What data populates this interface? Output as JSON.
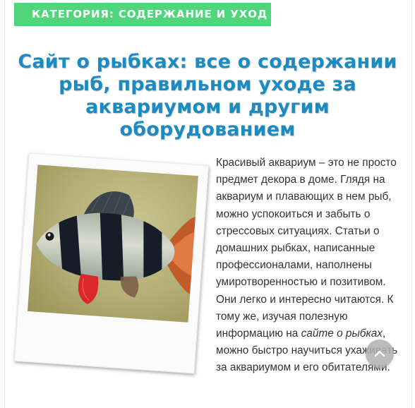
{
  "category": {
    "label": "КАТЕГОРИЯ: СОДЕРЖАНИЕ И УХОД"
  },
  "article": {
    "title": "Сайт о рыбках: все о содержании рыб, правильном уходе за аквариумом и другим оборудованием",
    "body_before_link": "Красивый аквариум – это не просто предмет декора в доме. Глядя на аквариум и плавающих в нем рыб, можно успокоиться и забыть о стрессовых ситуациях. Статьи о домашних рыбках, написанные профессионалами, наполнены умиротворенностью и позитивом. Они легко и интересно читаются. К тому же, изучая полезную информацию на ",
    "link_text": "сайте о рыбках",
    "body_after_link": ", можно быстро научиться ухаживать за аквариумом и его обитателями.",
    "image_icon": "tiger-barb-fish-photo"
  },
  "scroll_top": {
    "icon": "chevron-up-icon"
  },
  "colors": {
    "category_bg": "#4fd67b",
    "title": "#1c8bc2",
    "body_text": "#333333",
    "scroll_button": "#b0b0b0"
  }
}
